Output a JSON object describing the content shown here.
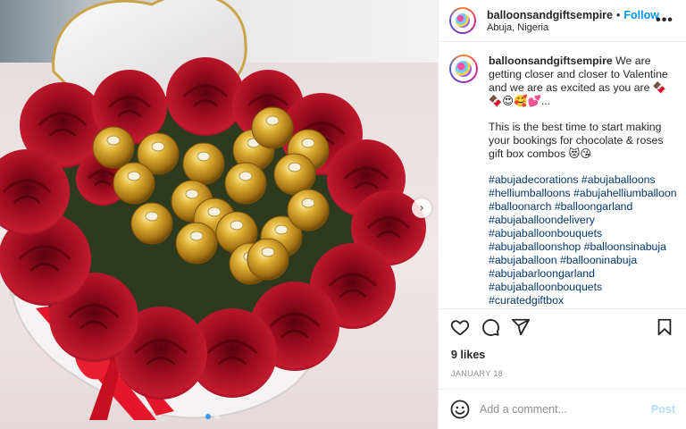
{
  "header": {
    "username": "balloonsandgiftsempire",
    "separator": "•",
    "follow_label": "Follow",
    "location": "Abuja, Nigeria",
    "more_icon": "more-horizontal-icon"
  },
  "caption": {
    "username": "balloonsandgiftsempire",
    "text_1": "We are getting closer and closer to Valentine and we are as excited as you are 🍫🍫😍🥰💕...",
    "text_2": "This is the best time to start making your bookings for chocolate & roses gift box combos 😻😘",
    "hashtags": [
      "#abujadecorations #abujaballoons",
      "#helliumballoons #abujahelliumballoon",
      "#balloonarch #balloongarland",
      "#abujaballoondelivery",
      "#abujaballoonbouquets",
      "#abujaballoonshop #balloonsinabuja",
      "#abujaballoon #ballooninabuja",
      "#abujabarloongarland",
      "#abujaballoonbouquets",
      "#curatedgiftbox"
    ]
  },
  "actions": {
    "like_icon": "heart-icon",
    "comment_icon": "comment-icon",
    "share_icon": "send-icon",
    "save_icon": "bookmark-icon"
  },
  "likes": "9 likes",
  "date": "JANUARY 18",
  "comment_box": {
    "emoji_icon": "smiley-icon",
    "placeholder": "Add a comment...",
    "post_label": "Post"
  },
  "media": {
    "carousel_next_icon": "chevron-right-icon",
    "carousel_pages": 2,
    "carousel_current": 1
  },
  "colors": {
    "link_blue": "#0095f6",
    "hashtag": "#00376b",
    "muted": "#8e8e8e",
    "post_disabled": "#b2dffc"
  }
}
